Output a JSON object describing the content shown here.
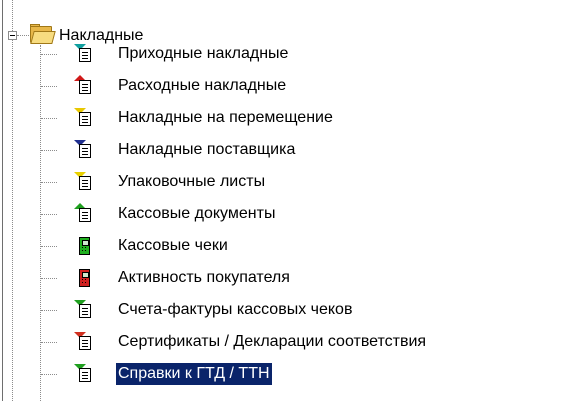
{
  "tree": {
    "root": {
      "label": "Накладные",
      "expanded": true
    },
    "items": [
      {
        "label": "Приходные накладные",
        "icon": "incoming-invoice-icon",
        "color": "#10a0a0",
        "selected": false
      },
      {
        "label": "Расходные накладные",
        "icon": "outgoing-invoice-icon",
        "color": "#d01818",
        "selected": false
      },
      {
        "label": "Накладные на перемещение",
        "icon": "transfer-invoice-icon",
        "color": "#e8c800",
        "selected": false
      },
      {
        "label": "Накладные поставщика",
        "icon": "supplier-invoice-icon",
        "color": "#203090",
        "selected": false
      },
      {
        "label": "Упаковочные листы",
        "icon": "packing-list-icon",
        "color": "#e8d000",
        "selected": false
      },
      {
        "label": "Кассовые документы",
        "icon": "cash-documents-icon",
        "color": "#20a020",
        "selected": false
      },
      {
        "label": "Кассовые чеки",
        "icon": "cash-receipts-icon",
        "color": "#20b020",
        "selected": false
      },
      {
        "label": "Активность покупателя",
        "icon": "customer-activity-icon",
        "color": "#d02020",
        "selected": false
      },
      {
        "label": "Счета-фактуры кассовых чеков",
        "icon": "receipt-invoices-icon",
        "color": "#20a020",
        "selected": false
      },
      {
        "label": "Сертификаты / Декларации соответствия",
        "icon": "certificates-icon",
        "color": "#d03020",
        "selected": false
      },
      {
        "label": "Справки к ГТД / ТТН",
        "icon": "customs-references-icon",
        "color": "#20a020",
        "selected": true
      }
    ]
  }
}
